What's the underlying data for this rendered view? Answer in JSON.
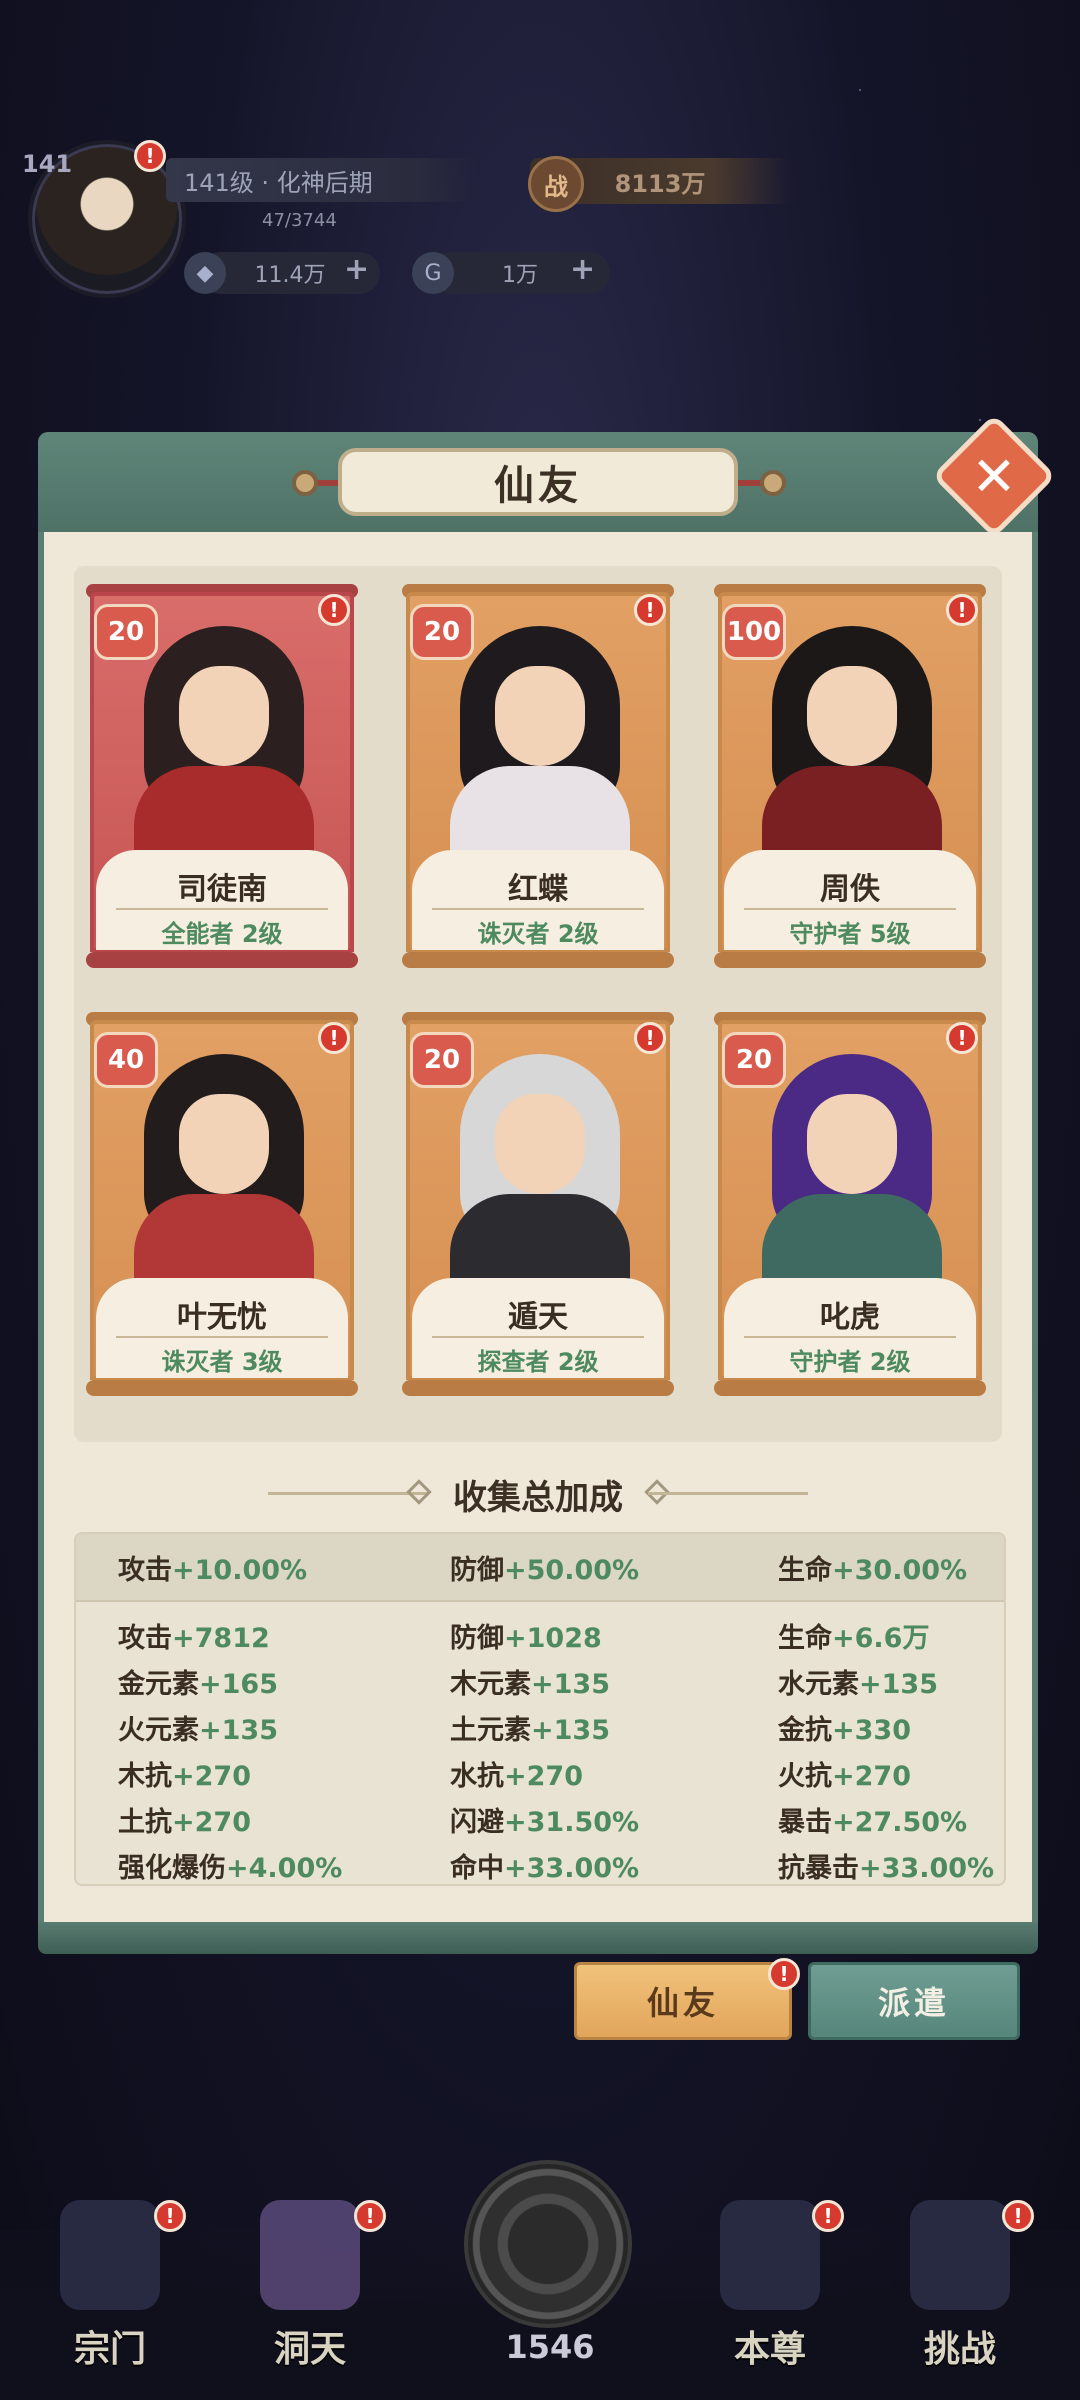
{
  "player": {
    "level_badge": "141",
    "title": "141级 · 化神后期",
    "exp": "47/3744",
    "power_icon": "战",
    "power": "8113万",
    "resource1": "11.4万",
    "resource2": "1万",
    "plus": "+"
  },
  "panel": {
    "title": "仙友",
    "close_glyph": "✕",
    "alert": "!",
    "characters": [
      {
        "name": "司徒南",
        "level": "20",
        "role": "全能者 2级",
        "theme": "red",
        "hair": "#2b1f1f",
        "clothes": "#a82c2c"
      },
      {
        "name": "红蝶",
        "level": "20",
        "role": "诛灭者 2级",
        "theme": "orange",
        "hair": "#1f1a1e",
        "clothes": "#e8e2e6"
      },
      {
        "name": "周佚",
        "level": "100",
        "role": "守护者 5级",
        "theme": "orange",
        "hair": "#1c1818",
        "clothes": "#7a1f22"
      },
      {
        "name": "叶无忧",
        "level": "40",
        "role": "诛灭者 3级",
        "theme": "orange",
        "hair": "#231c1c",
        "clothes": "#b23737"
      },
      {
        "name": "遁天",
        "level": "20",
        "role": "探查者 2级",
        "theme": "orange",
        "hair": "#d7d7d7",
        "clothes": "#2c2c30"
      },
      {
        "name": "叱虎",
        "level": "20",
        "role": "守护者 2级",
        "theme": "orange",
        "hair": "#4b2a86",
        "clothes": "#3f6a62"
      }
    ],
    "section_title": "收集总加成",
    "summary": [
      {
        "k": "攻击",
        "v": "+10.00%"
      },
      {
        "k": "防御",
        "v": "+50.00%"
      },
      {
        "k": "生命",
        "v": "+30.00%"
      }
    ],
    "stats": [
      {
        "k": "攻击",
        "v": "+7812"
      },
      {
        "k": "防御",
        "v": "+1028"
      },
      {
        "k": "生命",
        "v": "+6.6万"
      },
      {
        "k": "金元素",
        "v": "+165"
      },
      {
        "k": "木元素",
        "v": "+135"
      },
      {
        "k": "水元素",
        "v": "+135"
      },
      {
        "k": "火元素",
        "v": "+135"
      },
      {
        "k": "土元素",
        "v": "+135"
      },
      {
        "k": "金抗",
        "v": "+330"
      },
      {
        "k": "木抗",
        "v": "+270"
      },
      {
        "k": "水抗",
        "v": "+270"
      },
      {
        "k": "火抗",
        "v": "+270"
      },
      {
        "k": "土抗",
        "v": "+270"
      },
      {
        "k": "闪避",
        "v": "+31.50%"
      },
      {
        "k": "暴击",
        "v": "+27.50%"
      },
      {
        "k": "强化爆伤",
        "v": "+4.00%"
      },
      {
        "k": "命中",
        "v": "+33.00%"
      },
      {
        "k": "抗暴击",
        "v": "+33.00%"
      }
    ]
  },
  "tabs": {
    "active": "仙友",
    "idle": "派遣"
  },
  "nav": {
    "items": [
      {
        "label": "宗门"
      },
      {
        "label": "洞天"
      },
      {
        "label": "本尊"
      },
      {
        "label": "挑战"
      }
    ],
    "center_count": "1546"
  },
  "colors": {
    "accent_green": "#4e8a5f",
    "panel_teal": "#5a7e72",
    "alert_red": "#d63a2e"
  }
}
